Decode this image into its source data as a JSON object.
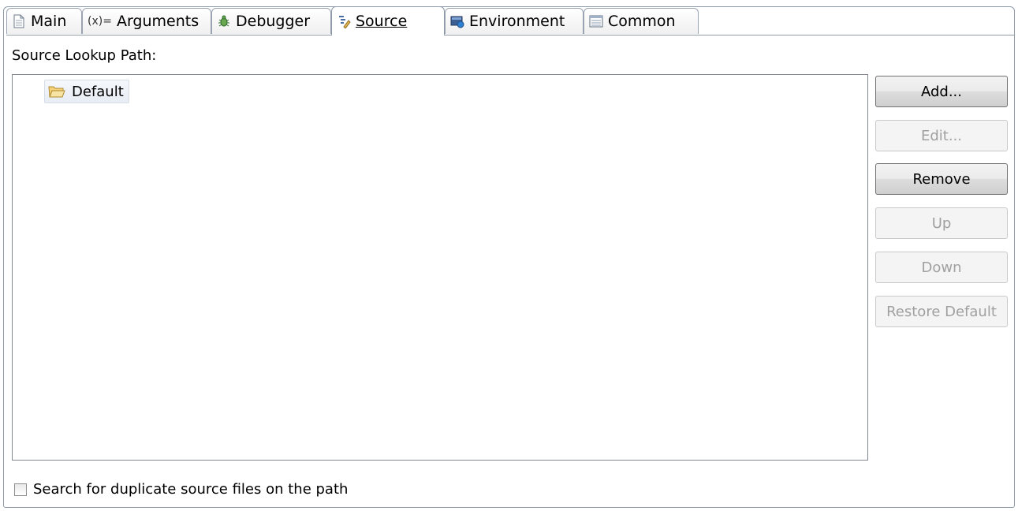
{
  "tabs": [
    {
      "label": "Main",
      "icon": "document-icon",
      "active": false
    },
    {
      "label": "Arguments",
      "icon": "arguments-icon",
      "prefix": "(x)=",
      "active": false
    },
    {
      "label": "Debugger",
      "icon": "bug-icon",
      "active": false
    },
    {
      "label": "Source",
      "icon": "source-icon",
      "active": true
    },
    {
      "label": "Environment",
      "icon": "environment-icon",
      "active": false
    },
    {
      "label": "Common",
      "icon": "common-icon",
      "active": false
    }
  ],
  "source_lookup": {
    "label": "Source Lookup Path:",
    "items": [
      {
        "label": "Default",
        "icon": "folder-open-icon"
      }
    ]
  },
  "buttons": {
    "add": "Add...",
    "edit": "Edit...",
    "remove": "Remove",
    "up": "Up",
    "down": "Down",
    "restore": "Restore Default"
  },
  "duplicate_checkbox": {
    "label": "Search for duplicate source files on the path",
    "checked": false
  }
}
